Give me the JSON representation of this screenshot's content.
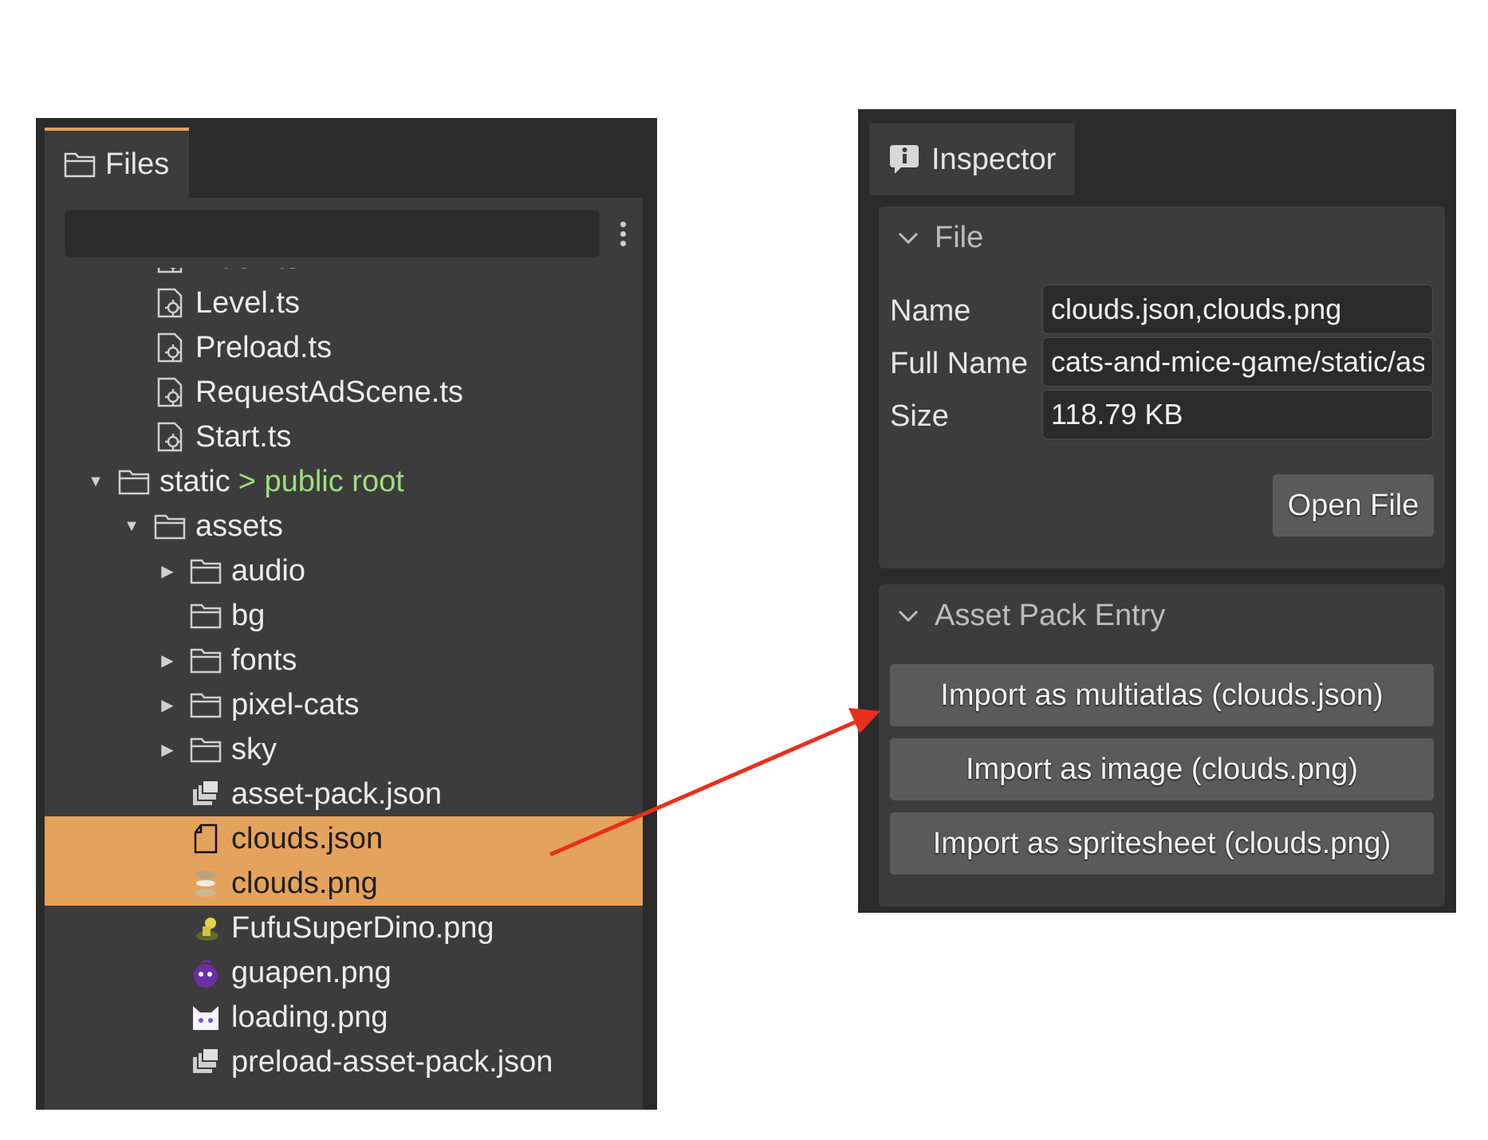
{
  "files_panel": {
    "tab_label": "Files",
    "filter_placeholder": "",
    "tree": [
      {
        "label": "index.ts",
        "icon": "script-file-icon",
        "depth": 2,
        "arrow": "none"
      },
      {
        "label": "Level.ts",
        "icon": "script-file-icon",
        "depth": 2,
        "arrow": "none"
      },
      {
        "label": "Preload.ts",
        "icon": "script-file-icon",
        "depth": 2,
        "arrow": "none"
      },
      {
        "label": "RequestAdScene.ts",
        "icon": "script-file-icon",
        "depth": 2,
        "arrow": "none"
      },
      {
        "label": "Start.ts",
        "icon": "script-file-icon",
        "depth": 2,
        "arrow": "none"
      },
      {
        "label": "static",
        "note": "> public root",
        "icon": "folder-icon",
        "depth": 1,
        "arrow": "expanded"
      },
      {
        "label": "assets",
        "icon": "folder-icon",
        "depth": 2,
        "arrow": "expanded"
      },
      {
        "label": "audio",
        "icon": "folder-icon",
        "depth": 3,
        "arrow": "collapsed"
      },
      {
        "label": "bg",
        "icon": "folder-icon",
        "depth": 3,
        "arrow": "none"
      },
      {
        "label": "fonts",
        "icon": "folder-icon",
        "depth": 3,
        "arrow": "collapsed"
      },
      {
        "label": "pixel-cats",
        "icon": "folder-icon",
        "depth": 3,
        "arrow": "collapsed"
      },
      {
        "label": "sky",
        "icon": "folder-icon",
        "depth": 3,
        "arrow": "collapsed"
      },
      {
        "label": "asset-pack.json",
        "icon": "asset-pack-icon",
        "depth": 3,
        "arrow": "none"
      },
      {
        "label": "clouds.json",
        "icon": "json-file-icon",
        "depth": 3,
        "arrow": "none",
        "selected": true
      },
      {
        "label": "clouds.png",
        "icon": "clouds-image-icon",
        "depth": 3,
        "arrow": "none",
        "selected": true
      },
      {
        "label": "FufuSuperDino.png",
        "icon": "dino-image-icon",
        "depth": 3,
        "arrow": "none"
      },
      {
        "label": "guapen.png",
        "icon": "guapen-image-icon",
        "depth": 3,
        "arrow": "none"
      },
      {
        "label": "loading.png",
        "icon": "cat-image-icon",
        "depth": 3,
        "arrow": "none"
      },
      {
        "label": "preload-asset-pack.json",
        "icon": "asset-pack-icon",
        "depth": 3,
        "arrow": "none"
      }
    ]
  },
  "inspector": {
    "tab_label": "Inspector",
    "file_section": {
      "title": "File",
      "name_label": "Name",
      "name_value": "clouds.json,clouds.png",
      "full_name_label": "Full Name",
      "full_name_value": "cats-and-mice-game/static/assets/clouds.json,cats-and-mice-game/static/assets/clouds.png",
      "size_label": "Size",
      "size_value": "118.79 KB",
      "open_button": "Open File"
    },
    "asset_pack_section": {
      "title": "Asset Pack Entry",
      "buttons": [
        "Import as multiatlas (clouds.json)",
        "Import as image (clouds.png)",
        "Import as spritesheet (clouds.png)"
      ]
    }
  },
  "colors": {
    "selection": "#e4a35d",
    "public_root_note": "#9be07a",
    "annotation_arrow": "#e8301c"
  }
}
